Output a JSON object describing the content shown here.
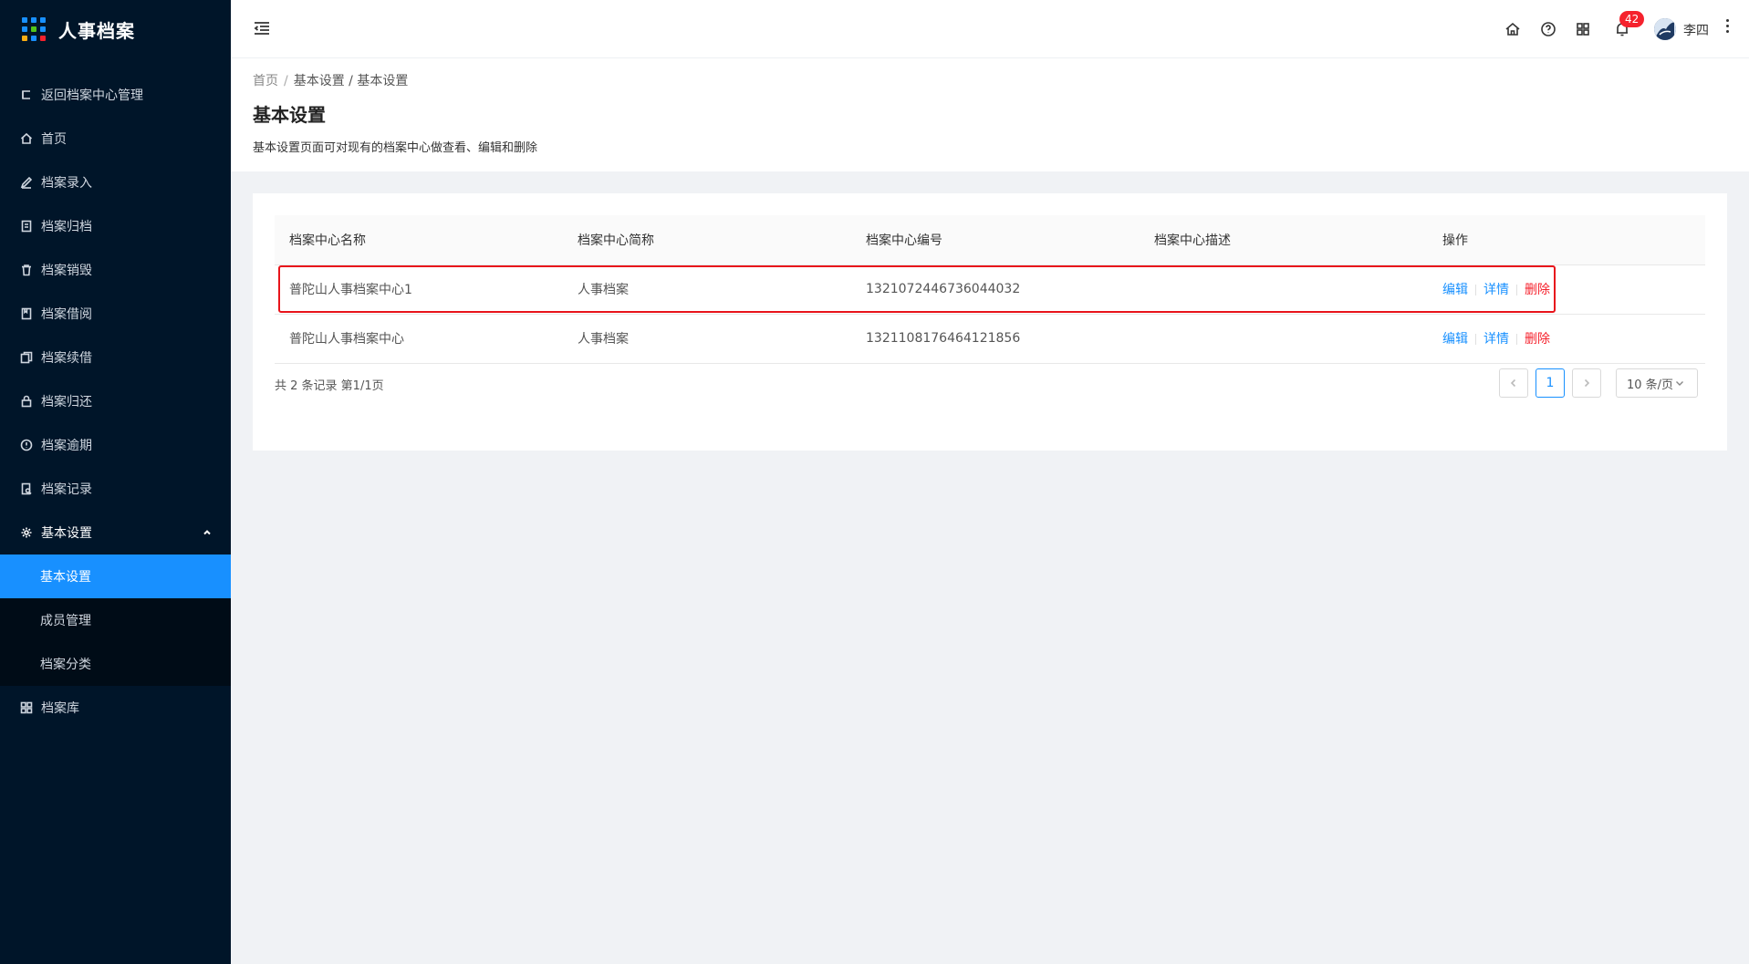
{
  "app": {
    "title": "人事档案"
  },
  "sidebar": {
    "items": [
      {
        "label": "返回档案中心管理",
        "icon": "return-icon"
      },
      {
        "label": "首页",
        "icon": "home-icon"
      },
      {
        "label": "档案录入",
        "icon": "edit-icon"
      },
      {
        "label": "档案归档",
        "icon": "archive-icon"
      },
      {
        "label": "档案销毁",
        "icon": "trash-icon"
      },
      {
        "label": "档案借阅",
        "icon": "book-icon"
      },
      {
        "label": "档案续借",
        "icon": "copy-icon"
      },
      {
        "label": "档案归还",
        "icon": "lock-icon"
      },
      {
        "label": "档案逾期",
        "icon": "alert-icon"
      },
      {
        "label": "档案记录",
        "icon": "record-icon"
      },
      {
        "label": "基本设置",
        "icon": "gear-icon"
      }
    ],
    "submenu": [
      {
        "label": "基本设置"
      },
      {
        "label": "成员管理"
      },
      {
        "label": "档案分类"
      }
    ],
    "after": [
      {
        "label": "档案库",
        "icon": "grid-icon"
      }
    ]
  },
  "header": {
    "notification_count": "42",
    "username": "李四"
  },
  "breadcrumb": {
    "home": "首页",
    "sep": "/",
    "path": "基本设置 / 基本设置"
  },
  "page": {
    "title": "基本设置",
    "description": "基本设置页面可对现有的档案中心做查看、编辑和删除"
  },
  "table": {
    "columns": [
      "档案中心名称",
      "档案中心简称",
      "档案中心编号",
      "档案中心描述",
      "操作"
    ],
    "rows": [
      {
        "name": "普陀山人事档案中心1",
        "short": "人事档案",
        "code": "1321072446736044032",
        "desc": ""
      },
      {
        "name": "普陀山人事档案中心",
        "short": "人事档案",
        "code": "1321108176464121856",
        "desc": ""
      }
    ],
    "actions": {
      "edit": "编辑",
      "detail": "详情",
      "delete": "删除"
    }
  },
  "pagination": {
    "total_text": "共 2 条记录 第1/1页",
    "current_page": "1",
    "page_size": "10 条/页"
  },
  "colors": {
    "sidebar_bg": "#001529",
    "accent": "#1890ff",
    "danger": "#f5222d",
    "highlight_border": "#e8141b"
  }
}
